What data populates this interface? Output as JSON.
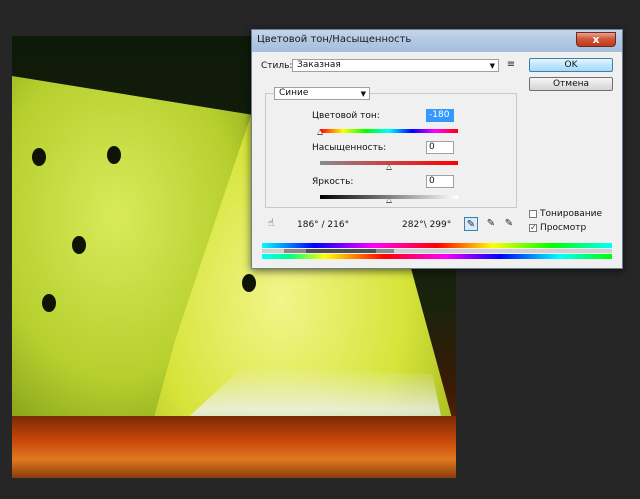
{
  "dialog": {
    "title": "Цветовой тон/Насыщенность",
    "close_label": "x",
    "style_label": "Стиль:",
    "style_value": "Заказная",
    "ok_label": "OK",
    "cancel_label": "Отмена",
    "channel_value": "Синие",
    "hue": {
      "label": "Цветовой тон:",
      "value": "-180",
      "fraction": 0.0
    },
    "saturation": {
      "label": "Насыщенность:",
      "value": "0",
      "fraction": 0.5
    },
    "lightness": {
      "label": "Яркость:",
      "value": "0",
      "fraction": 0.5
    },
    "range_left": "186° / 216°",
    "range_right": "282°\\ 299°",
    "colorize_label": "Тонирование",
    "colorize_checked": false,
    "preview_label": "Просмотр",
    "preview_checked": true,
    "preview_mark": "✓"
  },
  "colors": {
    "titlebar": "#b2c7e2",
    "close_button": "#c3381b",
    "selection": "#3399ff"
  }
}
